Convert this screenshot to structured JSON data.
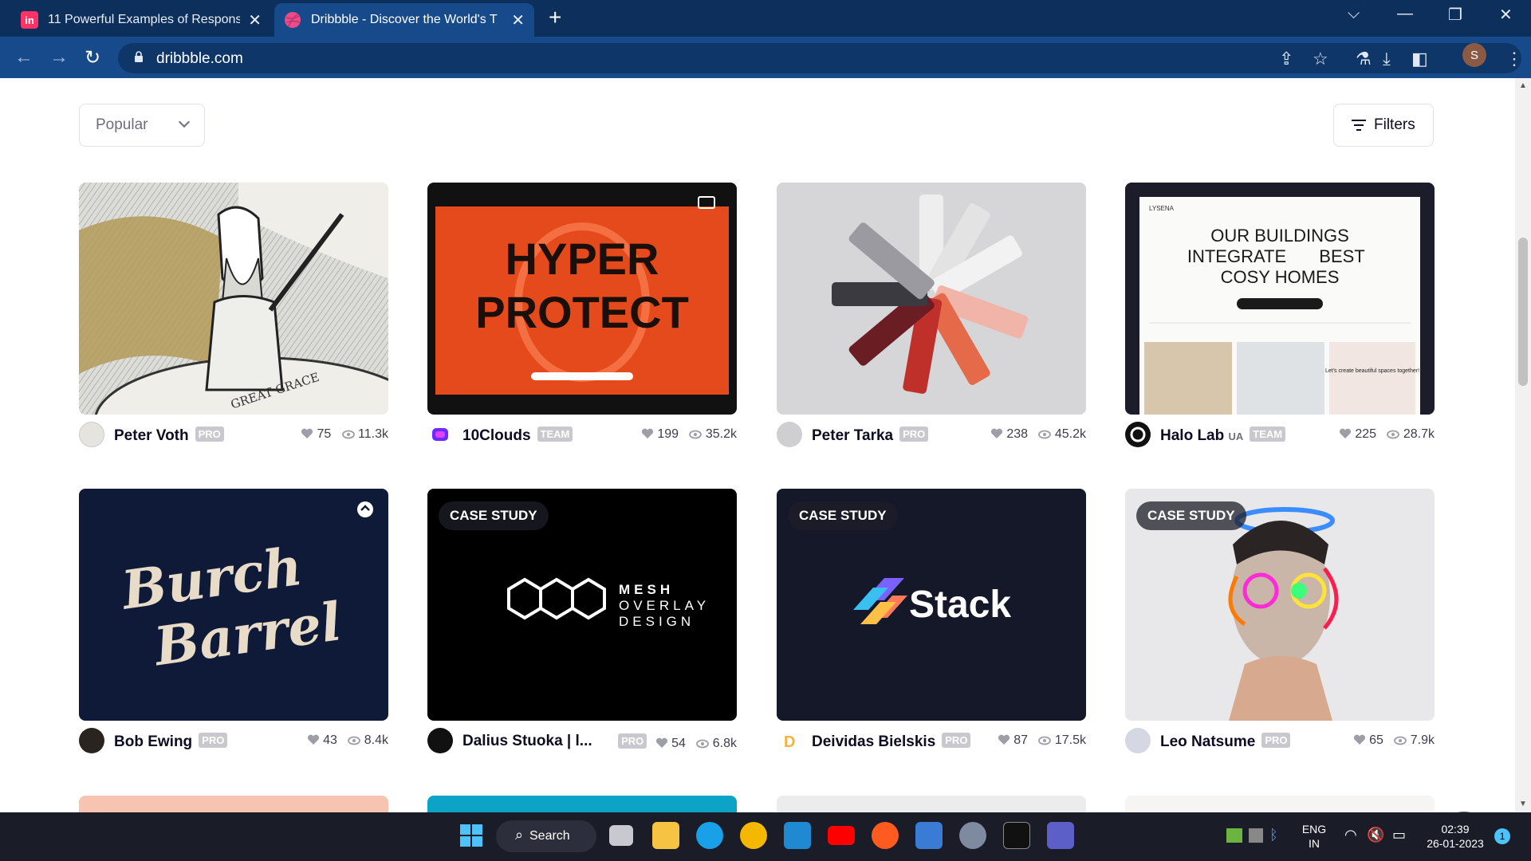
{
  "browser": {
    "tabs": [
      {
        "title": "11 Powerful Examples of Respons",
        "favicon": "in",
        "favicon_color": "#ff3366"
      },
      {
        "title": "Dribbble - Discover the World's T",
        "favicon": "dribbble",
        "favicon_color": "#ea4c89"
      }
    ],
    "url": "dribbble.com",
    "profile_initial": "S"
  },
  "toolbar": {
    "sort_label": "Popular",
    "filters_label": "Filters"
  },
  "shots": [
    {
      "author": "Peter Voth",
      "badge": "PRO",
      "likes": "75",
      "views": "11.3k",
      "tag": "",
      "art": "GREAT GRACE"
    },
    {
      "author": "10Clouds",
      "badge": "TEAM",
      "likes": "199",
      "views": "35.2k",
      "tag": "",
      "art_line1": "HYPER",
      "art_line2": "PROTECT"
    },
    {
      "author": "Peter Tarka",
      "badge": "PRO",
      "likes": "238",
      "views": "45.2k",
      "tag": ""
    },
    {
      "author": "Halo Lab",
      "author_suffix": "UA",
      "badge": "TEAM",
      "likes": "225",
      "views": "28.7k",
      "tag": "",
      "art_brand": "LYSENA",
      "art_line1": "OUR BUILDINGS",
      "art_line2": "INTEGRATE",
      "art_line2b": "BEST",
      "art_line3": "COSY HOMES",
      "art_caption": "Let's create beautiful spaces together!"
    },
    {
      "author": "Bob Ewing",
      "badge": "PRO",
      "likes": "43",
      "views": "8.4k",
      "tag": "",
      "art_line1": "Burch",
      "art_line2": "Barrel"
    },
    {
      "author": "Dalius Stuoka | l...",
      "badge": "PRO",
      "likes": "54",
      "views": "6.8k",
      "tag": "CASE STUDY",
      "art_line1": "MESH",
      "art_line2": "OVERLAY",
      "art_line3": "DESIGN"
    },
    {
      "author": "Deividas Bielskis",
      "badge": "PRO",
      "likes": "87",
      "views": "17.5k",
      "tag": "CASE STUDY",
      "art_line1": "Stack"
    },
    {
      "author": "Leo Natsume",
      "badge": "PRO",
      "likes": "65",
      "views": "7.9k",
      "tag": "CASE STUDY"
    }
  ],
  "taskbar": {
    "search_label": "Search",
    "lang_line1": "ENG",
    "lang_line2": "IN",
    "time": "02:39",
    "date": "26-01-2023",
    "notification_count": "1"
  },
  "colors": {
    "chrome_dark": "#0d2f5c",
    "chrome_active": "#164a8a",
    "badge": "#c8c8ce",
    "text": "#0d0c22"
  }
}
